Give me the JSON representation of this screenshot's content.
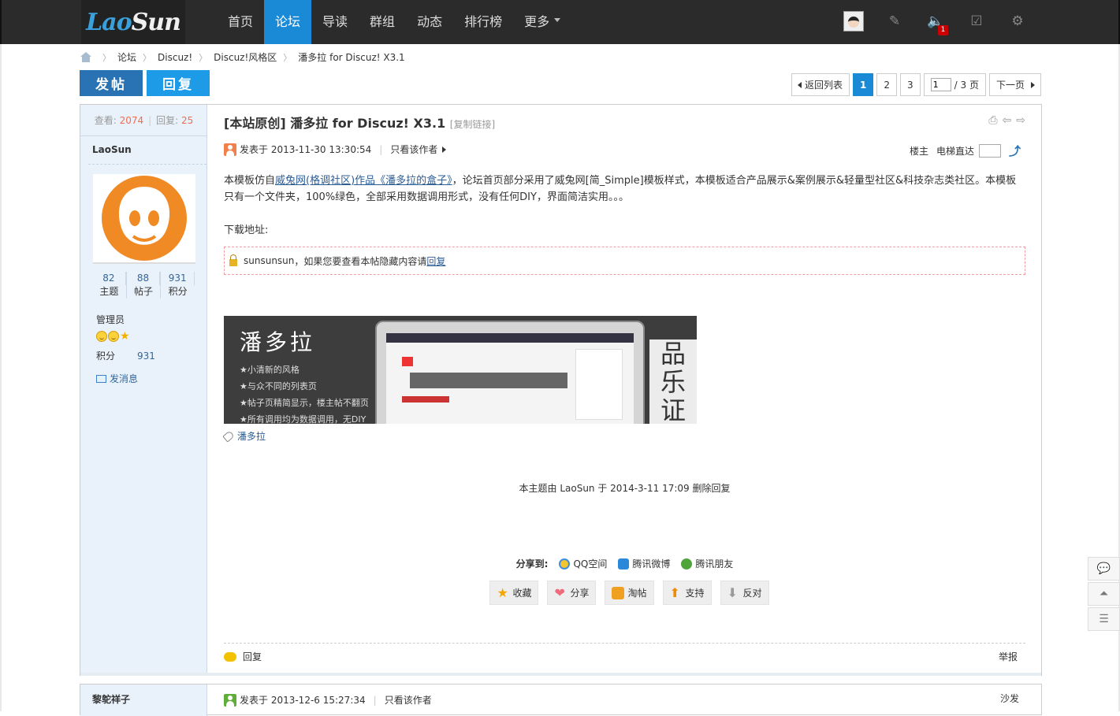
{
  "header": {
    "logo_part1": "Lao",
    "logo_part2": "Sun",
    "nav": [
      "首页",
      "论坛",
      "导读",
      "群组",
      "动态",
      "排行榜",
      "更多"
    ],
    "notice_count": "1",
    "icons": [
      "avatar",
      "pen-icon",
      "speaker-icon",
      "checkbox-icon",
      "gear-icon"
    ]
  },
  "breadcrumb": [
    "论坛",
    "Discuz!",
    "Discuz!风格区",
    "潘多拉 for Discuz! X3.1"
  ],
  "buttons": {
    "post": "发帖",
    "reply": "回复"
  },
  "pager": {
    "back": "返回列表",
    "pages": [
      "1",
      "2",
      "3"
    ],
    "current": "1",
    "input_value": "1",
    "total": "/ 3 页",
    "next": "下一页"
  },
  "thread": {
    "views_label": "查看:",
    "views": "2074",
    "replies_label": "回复:",
    "replies": "25",
    "title": "[本站原创] 潘多拉 for Discuz! X3.1",
    "copy_link": "[复制链接]"
  },
  "author": {
    "name": "LaoSun",
    "stats": [
      {
        "value": "82",
        "label": "主题"
      },
      {
        "value": "88",
        "label": "帖子"
      },
      {
        "value": "931",
        "label": "积分"
      }
    ],
    "role": "管理员",
    "points_label": "积分",
    "points": "931",
    "send_msg": "发消息"
  },
  "post": {
    "posted_at": "发表于 2013-11-30 13:30:54",
    "only_author": "只看该作者",
    "floor": "楼主",
    "elevator": "电梯直达",
    "body_prefix": "本模板仿自",
    "body_link": "威兔网(格调社区)作品《潘多拉的盒子》",
    "body_suffix": "，论坛首页部分采用了威兔网[简_Simple]模板样式，本模板适合产品展示&案例展示&轻量型社区&科技杂志类社区。本模板只有一个文件夹，100%绿色，全部采用数据调用形式，没有任何DIY，界面简洁实用。。。",
    "download": "下载地址:",
    "hidden_user": "sunsunsun",
    "hidden_text": "，如果您要查看本帖隐藏内容请",
    "hidden_link": "回复",
    "banner_title": "潘多拉",
    "banner_features": [
      "★小清新的风格",
      "★与众不同的列表页",
      "★帖子页精简显示，楼主帖不翻页",
      "★所有调用均为数据调用，无DIY"
    ],
    "banner_side": "品乐证",
    "tag": "潘多拉",
    "mod_note": "本主题由 LaoSun 于 2014-3-11 17:09 删除回复",
    "share_label": "分享到:",
    "share": [
      "QQ空间",
      "腾讯微博",
      "腾讯朋友"
    ],
    "actions": [
      "收藏",
      "分享",
      "淘帖",
      "支持",
      "反对"
    ],
    "reply": "回复",
    "report": "举报"
  },
  "post2": {
    "author": "黎鸵祥子",
    "posted_at": "发表于 2013-12-6 15:27:34",
    "only_author": "只看该作者",
    "floor": "沙发"
  },
  "colors": {
    "nav_active": "#1a8ad6",
    "post_btn": "#2973b5",
    "reply_btn": "#1e9be6",
    "count": "#f26c4f",
    "link": "#2c5c94"
  }
}
